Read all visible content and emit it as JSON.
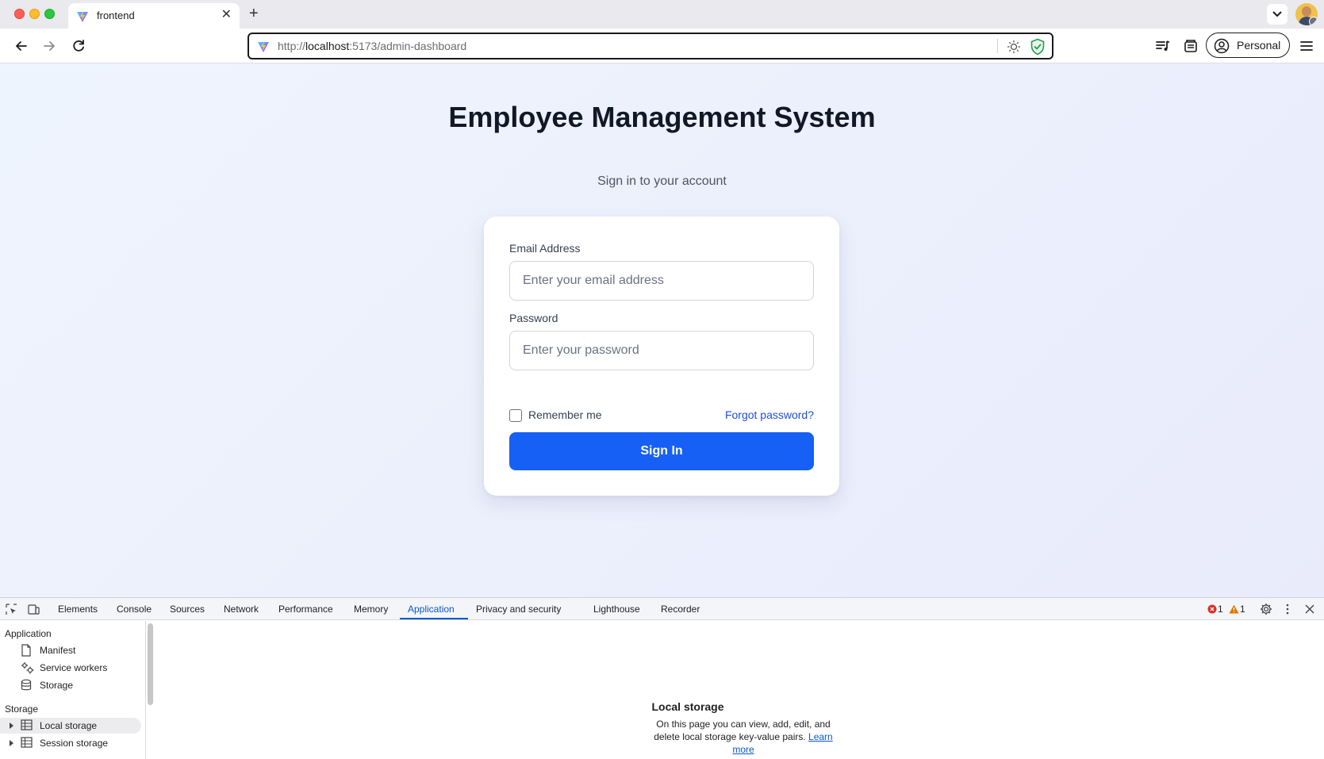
{
  "browser": {
    "tab_title": "frontend",
    "url_scheme": "http://",
    "url_host": "localhost",
    "url_rest": ":5173/admin-dashboard",
    "profile_label": "Personal"
  },
  "page": {
    "title": "Employee Management System",
    "subtitle": "Sign in to your account",
    "form": {
      "email_label": "Email Address",
      "email_placeholder": "Enter your email address",
      "password_label": "Password",
      "password_placeholder": "Enter your password",
      "remember_label": "Remember me",
      "forgot_label": "Forgot password?",
      "signin_label": "Sign In"
    },
    "colors": {
      "primary": "#1660f5",
      "link": "#1d4ed8"
    }
  },
  "devtools": {
    "tabs": [
      "Elements",
      "Console",
      "Sources",
      "Network",
      "Performance",
      "Memory",
      "Application",
      "Privacy and security",
      "Lighthouse",
      "Recorder"
    ],
    "active_tab": "Application",
    "error_count": "1",
    "warning_count": "1",
    "sidebar": {
      "application_heading": "Application",
      "application_items": [
        "Manifest",
        "Service workers",
        "Storage"
      ],
      "storage_heading": "Storage",
      "storage_items": [
        "Local storage",
        "Session storage"
      ]
    },
    "main": {
      "empty_title": "Local storage",
      "empty_desc": "On this page you can view, add, edit, and delete local storage key-value pairs.",
      "learn_more": "Learn more"
    }
  }
}
